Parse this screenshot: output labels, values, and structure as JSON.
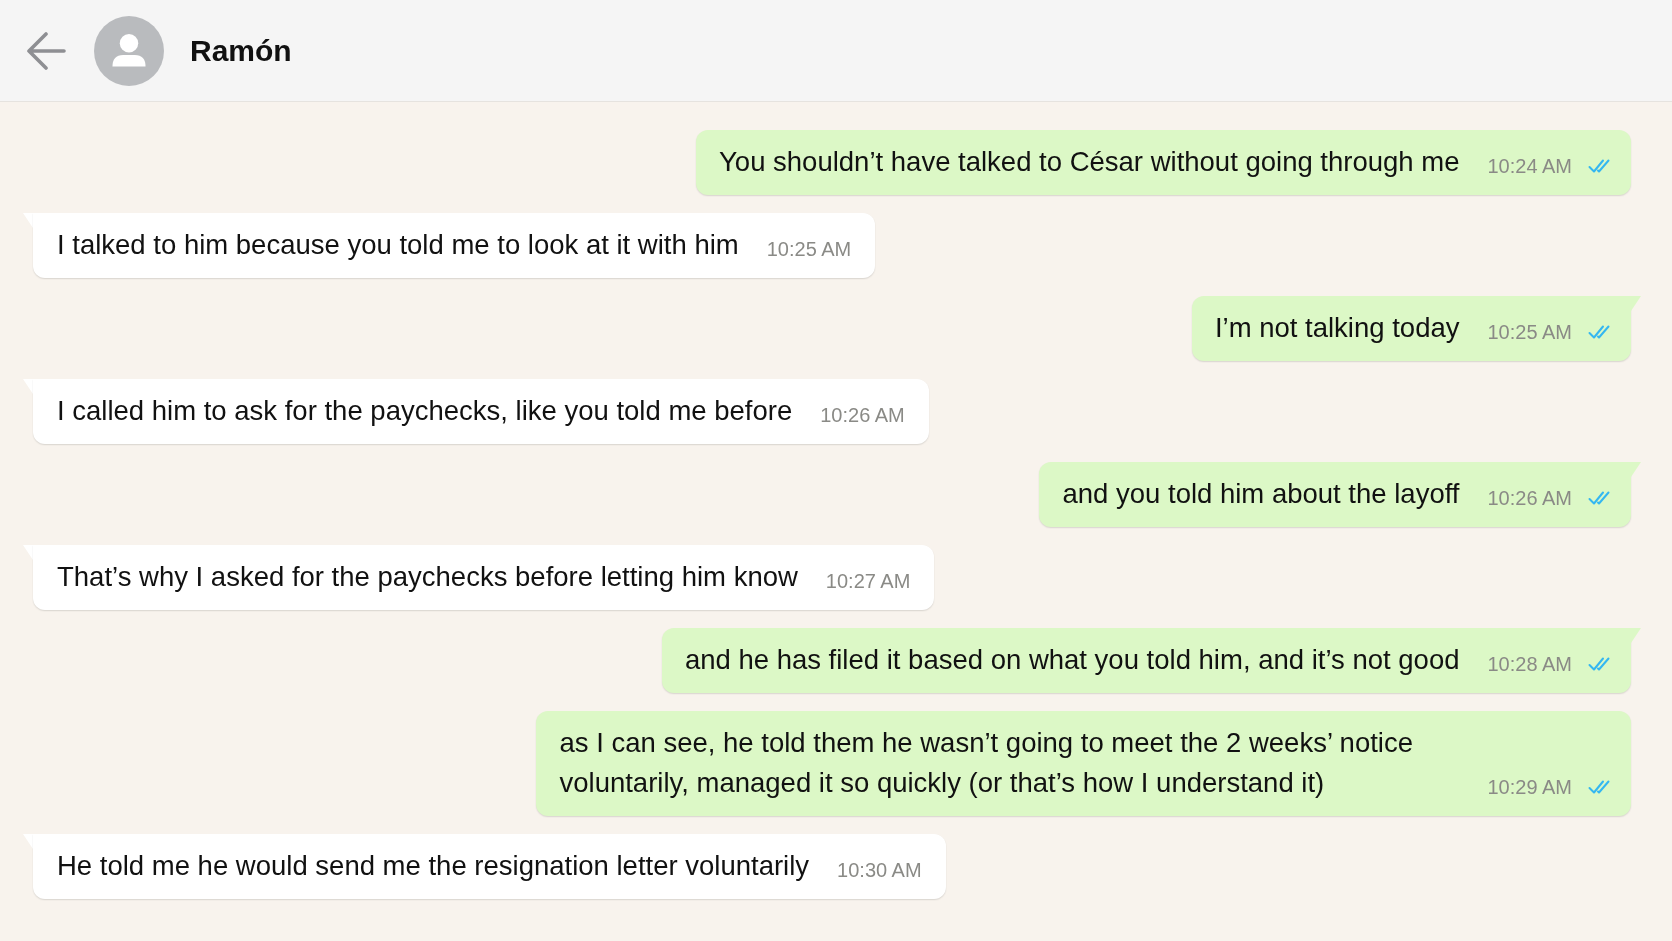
{
  "header": {
    "contact_name": "Ramón"
  },
  "messages": [
    {
      "kind": "outgoing",
      "text": "You shouldn’t have talked to César without going through me",
      "time": "10:24 AM",
      "read": true,
      "tail": false
    },
    {
      "kind": "incoming",
      "text": "I talked to him because you told me to look at it with him",
      "time": "10:25 AM",
      "tail": true
    },
    {
      "kind": "outgoing",
      "text": "I’m not talking today",
      "time": "10:25 AM",
      "read": true,
      "tail": true
    },
    {
      "kind": "incoming",
      "text": "I called him to ask for the paychecks, like you told me before",
      "time": "10:26 AM",
      "tail": true
    },
    {
      "kind": "outgoing",
      "text": "and you told him about the layoff",
      "time": "10:26 AM",
      "read": true,
      "tail": true
    },
    {
      "kind": "incoming",
      "text": "That’s why I asked for the paychecks before letting him know",
      "time": "10:27 AM",
      "tail": true
    },
    {
      "kind": "outgoing",
      "text": "and he has filed it based on what you told him, and it’s not good",
      "time": "10:28 AM",
      "read": true,
      "tail": true
    },
    {
      "kind": "outgoing",
      "text": "as I can see, he told them he wasn’t going to meet the 2 weeks’ notice voluntarily, managed it so quickly (or that’s how I understand it)",
      "time": "10:29 AM",
      "read": true,
      "tail": false
    },
    {
      "kind": "incoming",
      "text": "He told me he would send me the resignation letter voluntarily",
      "time": "10:30 AM",
      "tail": true
    }
  ]
}
